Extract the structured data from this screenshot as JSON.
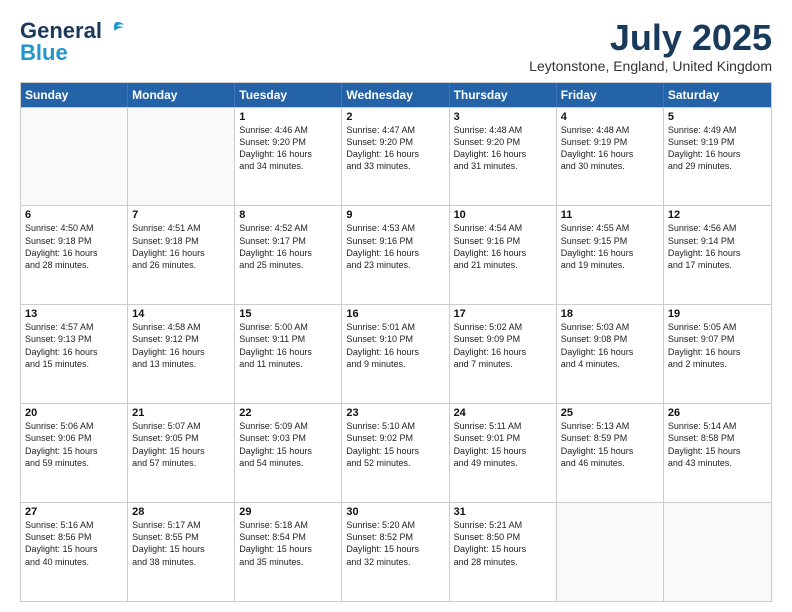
{
  "header": {
    "logo_general": "General",
    "logo_blue": "Blue",
    "month_year": "July 2025",
    "location": "Leytonstone, England, United Kingdom"
  },
  "days_of_week": [
    "Sunday",
    "Monday",
    "Tuesday",
    "Wednesday",
    "Thursday",
    "Friday",
    "Saturday"
  ],
  "weeks": [
    [
      {
        "day": "",
        "info": "",
        "empty": true
      },
      {
        "day": "",
        "info": "",
        "empty": true
      },
      {
        "day": "1",
        "info": "Sunrise: 4:46 AM\nSunset: 9:20 PM\nDaylight: 16 hours\nand 34 minutes."
      },
      {
        "day": "2",
        "info": "Sunrise: 4:47 AM\nSunset: 9:20 PM\nDaylight: 16 hours\nand 33 minutes."
      },
      {
        "day": "3",
        "info": "Sunrise: 4:48 AM\nSunset: 9:20 PM\nDaylight: 16 hours\nand 31 minutes."
      },
      {
        "day": "4",
        "info": "Sunrise: 4:48 AM\nSunset: 9:19 PM\nDaylight: 16 hours\nand 30 minutes."
      },
      {
        "day": "5",
        "info": "Sunrise: 4:49 AM\nSunset: 9:19 PM\nDaylight: 16 hours\nand 29 minutes."
      }
    ],
    [
      {
        "day": "6",
        "info": "Sunrise: 4:50 AM\nSunset: 9:18 PM\nDaylight: 16 hours\nand 28 minutes."
      },
      {
        "day": "7",
        "info": "Sunrise: 4:51 AM\nSunset: 9:18 PM\nDaylight: 16 hours\nand 26 minutes."
      },
      {
        "day": "8",
        "info": "Sunrise: 4:52 AM\nSunset: 9:17 PM\nDaylight: 16 hours\nand 25 minutes."
      },
      {
        "day": "9",
        "info": "Sunrise: 4:53 AM\nSunset: 9:16 PM\nDaylight: 16 hours\nand 23 minutes."
      },
      {
        "day": "10",
        "info": "Sunrise: 4:54 AM\nSunset: 9:16 PM\nDaylight: 16 hours\nand 21 minutes."
      },
      {
        "day": "11",
        "info": "Sunrise: 4:55 AM\nSunset: 9:15 PM\nDaylight: 16 hours\nand 19 minutes."
      },
      {
        "day": "12",
        "info": "Sunrise: 4:56 AM\nSunset: 9:14 PM\nDaylight: 16 hours\nand 17 minutes."
      }
    ],
    [
      {
        "day": "13",
        "info": "Sunrise: 4:57 AM\nSunset: 9:13 PM\nDaylight: 16 hours\nand 15 minutes."
      },
      {
        "day": "14",
        "info": "Sunrise: 4:58 AM\nSunset: 9:12 PM\nDaylight: 16 hours\nand 13 minutes."
      },
      {
        "day": "15",
        "info": "Sunrise: 5:00 AM\nSunset: 9:11 PM\nDaylight: 16 hours\nand 11 minutes."
      },
      {
        "day": "16",
        "info": "Sunrise: 5:01 AM\nSunset: 9:10 PM\nDaylight: 16 hours\nand 9 minutes."
      },
      {
        "day": "17",
        "info": "Sunrise: 5:02 AM\nSunset: 9:09 PM\nDaylight: 16 hours\nand 7 minutes."
      },
      {
        "day": "18",
        "info": "Sunrise: 5:03 AM\nSunset: 9:08 PM\nDaylight: 16 hours\nand 4 minutes."
      },
      {
        "day": "19",
        "info": "Sunrise: 5:05 AM\nSunset: 9:07 PM\nDaylight: 16 hours\nand 2 minutes."
      }
    ],
    [
      {
        "day": "20",
        "info": "Sunrise: 5:06 AM\nSunset: 9:06 PM\nDaylight: 15 hours\nand 59 minutes."
      },
      {
        "day": "21",
        "info": "Sunrise: 5:07 AM\nSunset: 9:05 PM\nDaylight: 15 hours\nand 57 minutes."
      },
      {
        "day": "22",
        "info": "Sunrise: 5:09 AM\nSunset: 9:03 PM\nDaylight: 15 hours\nand 54 minutes."
      },
      {
        "day": "23",
        "info": "Sunrise: 5:10 AM\nSunset: 9:02 PM\nDaylight: 15 hours\nand 52 minutes."
      },
      {
        "day": "24",
        "info": "Sunrise: 5:11 AM\nSunset: 9:01 PM\nDaylight: 15 hours\nand 49 minutes."
      },
      {
        "day": "25",
        "info": "Sunrise: 5:13 AM\nSunset: 8:59 PM\nDaylight: 15 hours\nand 46 minutes."
      },
      {
        "day": "26",
        "info": "Sunrise: 5:14 AM\nSunset: 8:58 PM\nDaylight: 15 hours\nand 43 minutes."
      }
    ],
    [
      {
        "day": "27",
        "info": "Sunrise: 5:16 AM\nSunset: 8:56 PM\nDaylight: 15 hours\nand 40 minutes."
      },
      {
        "day": "28",
        "info": "Sunrise: 5:17 AM\nSunset: 8:55 PM\nDaylight: 15 hours\nand 38 minutes."
      },
      {
        "day": "29",
        "info": "Sunrise: 5:18 AM\nSunset: 8:54 PM\nDaylight: 15 hours\nand 35 minutes."
      },
      {
        "day": "30",
        "info": "Sunrise: 5:20 AM\nSunset: 8:52 PM\nDaylight: 15 hours\nand 32 minutes."
      },
      {
        "day": "31",
        "info": "Sunrise: 5:21 AM\nSunset: 8:50 PM\nDaylight: 15 hours\nand 28 minutes."
      },
      {
        "day": "",
        "info": "",
        "empty": true
      },
      {
        "day": "",
        "info": "",
        "empty": true
      }
    ]
  ]
}
